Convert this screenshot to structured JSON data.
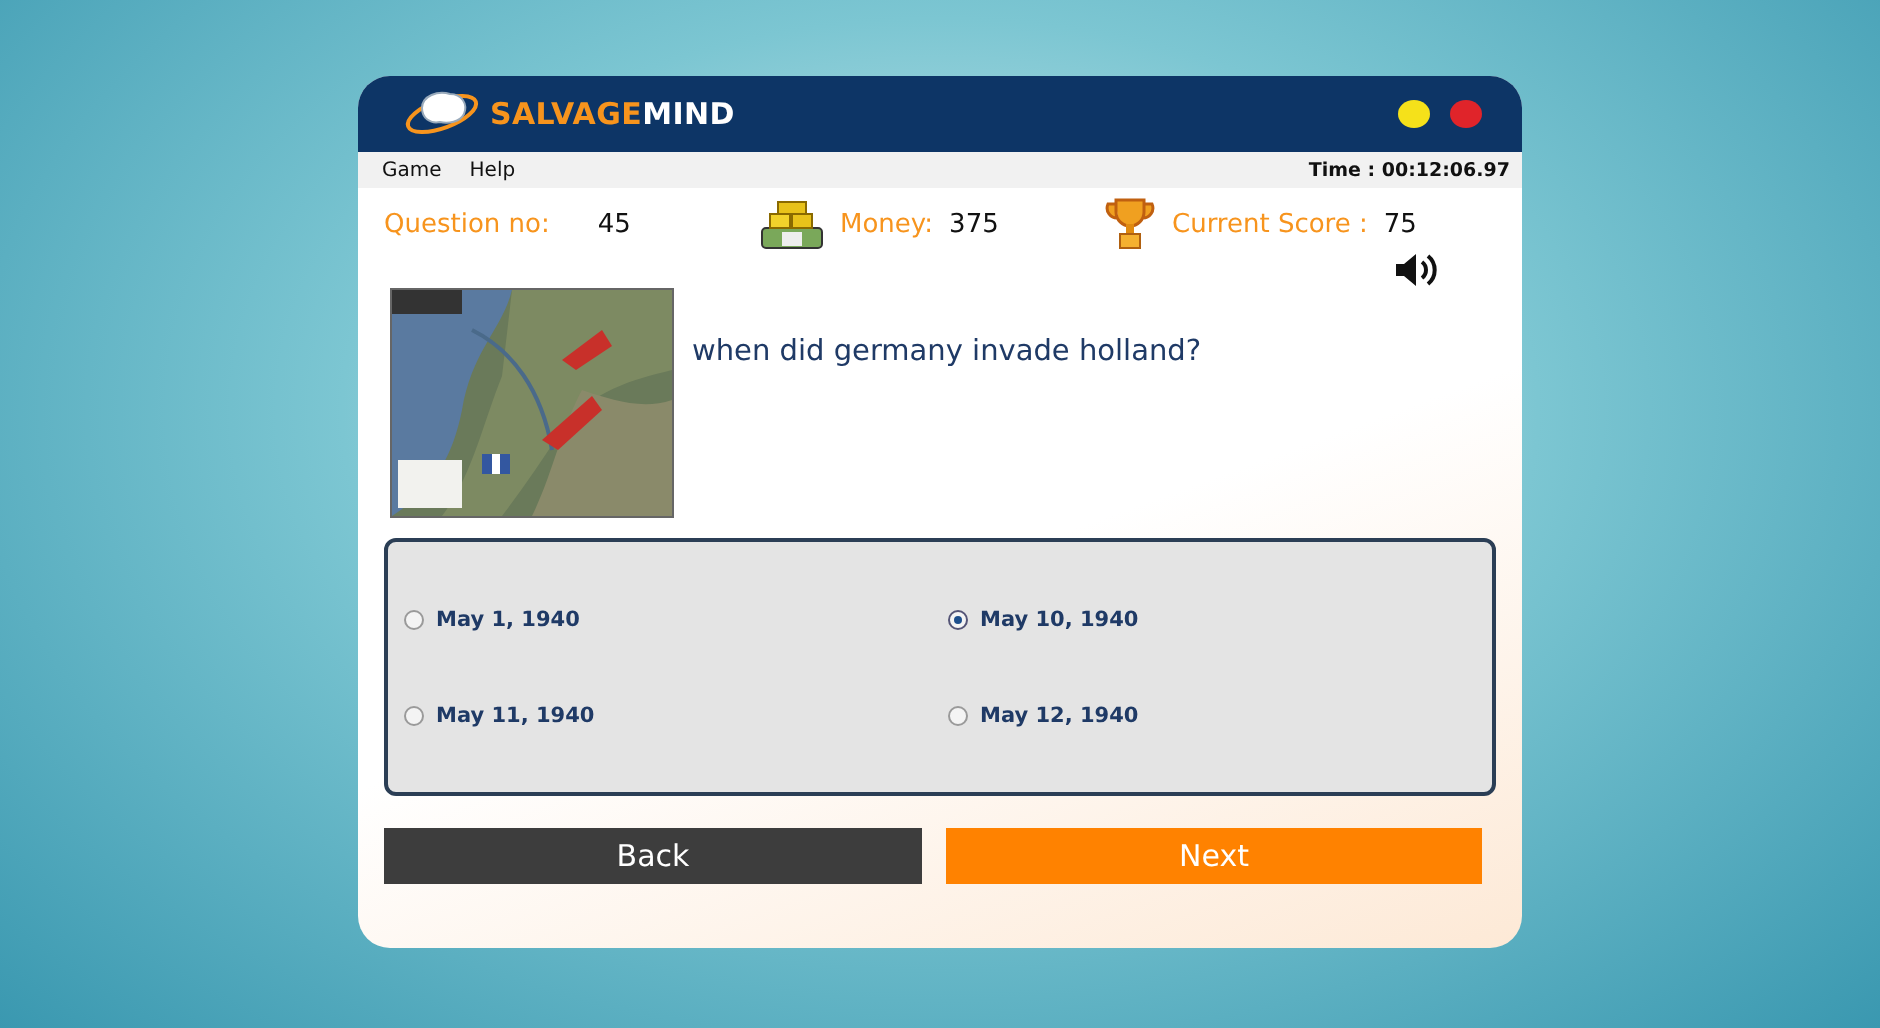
{
  "header": {
    "logo": {
      "first": "SALVAGE",
      "second": "MIND"
    }
  },
  "menu": [
    "Game",
    "Help"
  ],
  "timer": "Time : 00:12:06.97",
  "stats": [
    {
      "kind": "plain",
      "label": "Question no:",
      "value": "45"
    },
    {
      "kind": "money",
      "label": "Money:",
      "value": "375"
    },
    {
      "kind": "trophy",
      "label": "Current Score :",
      "value": "75"
    }
  ],
  "question": {
    "text": "when did germany invade holland?"
  },
  "options": [
    {
      "label": "May 1, 1940",
      "selected": false
    },
    {
      "label": "May 10, 1940",
      "selected": true
    },
    {
      "label": "May 11, 1940",
      "selected": false
    },
    {
      "label": "May 12, 1940",
      "selected": false
    }
  ],
  "buttons": [
    {
      "kind": "back",
      "label": "Back"
    },
    {
      "kind": "next",
      "label": "Next"
    }
  ]
}
